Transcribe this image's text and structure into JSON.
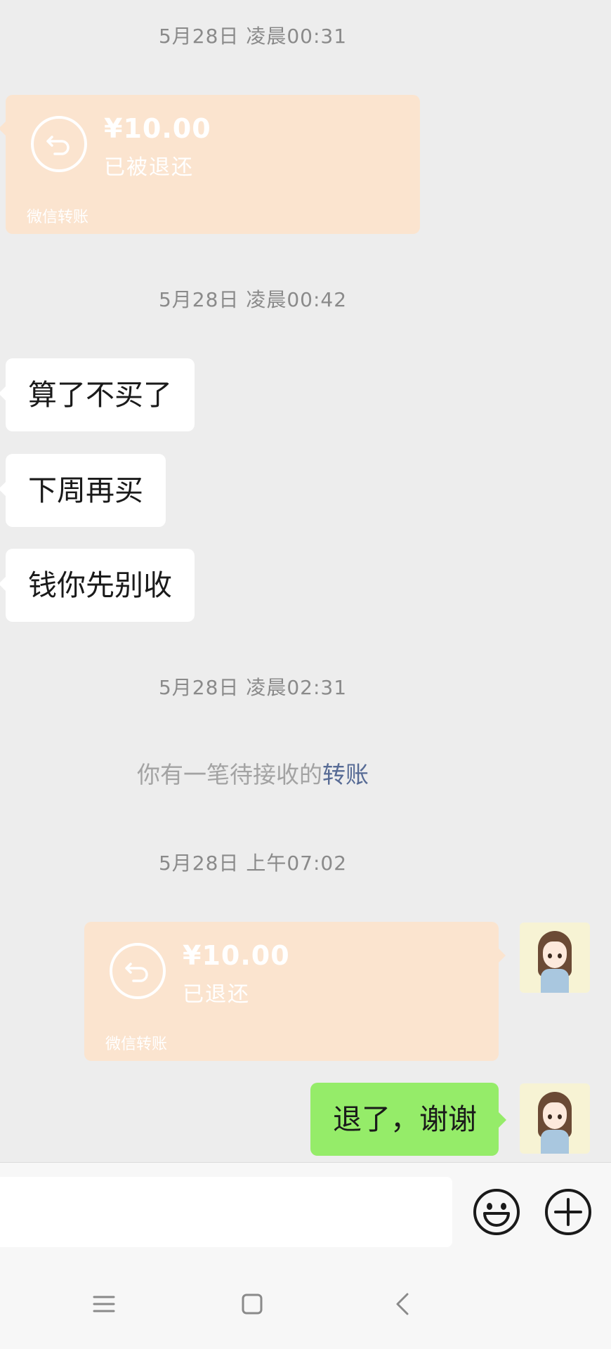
{
  "timestamps": [
    "5月28日 凌晨00:31",
    "5月28日 凌晨00:42",
    "5月28日 凌晨02:31",
    "5月28日 上午07:02"
  ],
  "transfer_in": {
    "amount": "¥10.00",
    "status": "已被退还",
    "source": "微信转账",
    "icon": "return-arrow-icon"
  },
  "messages_received": [
    "算了不买了",
    "下周再买",
    "钱你先别收"
  ],
  "system_notice": {
    "text": "你有一笔待接收的",
    "link": "转账"
  },
  "transfer_out": {
    "amount": "¥10.00",
    "status": "已退还",
    "source": "微信转账",
    "icon": "return-arrow-icon"
  },
  "message_sent": "退了，谢谢",
  "input": {
    "placeholder": "",
    "emoji_icon": "emoji-icon",
    "more_icon": "plus-circle-icon"
  },
  "system_nav": {
    "menu_icon": "menu-icon",
    "home_icon": "home-square-icon",
    "back_icon": "back-chevron-icon"
  },
  "colors": {
    "background": "#ededed",
    "transfer_bubble": "#fbe4cf",
    "sent_bubble": "#95ec69",
    "link": "#576b95"
  }
}
